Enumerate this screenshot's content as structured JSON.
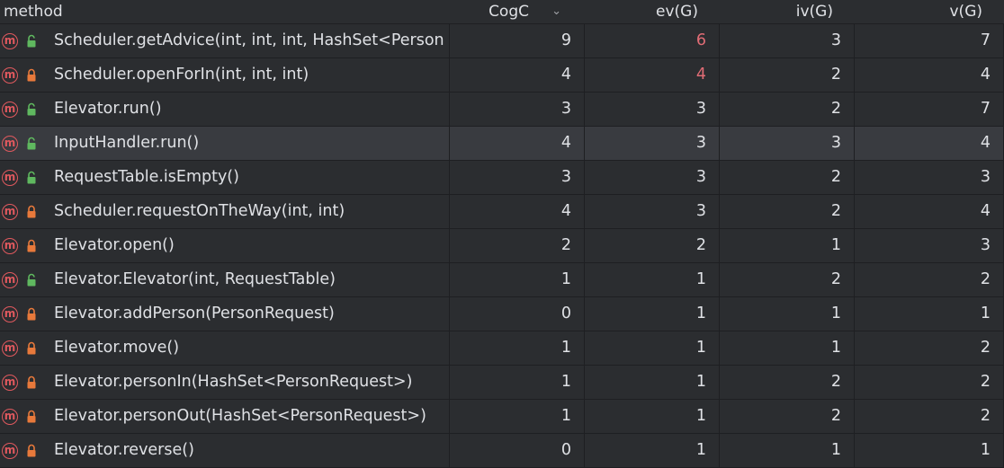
{
  "header": {
    "method": "method",
    "cogc": "CogC",
    "cogc_sort_icon": "chevron-down-icon",
    "ev": "ev(G)",
    "iv": "iv(G)",
    "v": "v(G)"
  },
  "colors": {
    "background": "#2b2d30",
    "selected_row": "#393b40",
    "method_icon": "#e0595e",
    "public_lock": "#5fb85f",
    "private_lock": "#e8793b",
    "highlight_value": "#e06c75"
  },
  "rows": [
    {
      "method": "Scheduler.getAdvice(int, int, int, HashSet<Person",
      "access": "public",
      "cogc": "9",
      "ev": "6",
      "iv": "3",
      "v": "7",
      "ev_highlight": true
    },
    {
      "method": "Scheduler.openForIn(int, int, int)",
      "access": "private",
      "cogc": "4",
      "ev": "4",
      "iv": "2",
      "v": "4",
      "ev_highlight": true
    },
    {
      "method": "Elevator.run()",
      "access": "public",
      "cogc": "3",
      "ev": "3",
      "iv": "2",
      "v": "7"
    },
    {
      "method": "InputHandler.run()",
      "access": "public",
      "cogc": "4",
      "ev": "3",
      "iv": "3",
      "v": "4",
      "selected": true
    },
    {
      "method": "RequestTable.isEmpty()",
      "access": "public",
      "cogc": "3",
      "ev": "3",
      "iv": "2",
      "v": "3"
    },
    {
      "method": "Scheduler.requestOnTheWay(int, int)",
      "access": "private",
      "cogc": "4",
      "ev": "3",
      "iv": "2",
      "v": "4"
    },
    {
      "method": "Elevator.open()",
      "access": "private",
      "cogc": "2",
      "ev": "2",
      "iv": "1",
      "v": "3"
    },
    {
      "method": "Elevator.Elevator(int, RequestTable)",
      "access": "public",
      "cogc": "1",
      "ev": "1",
      "iv": "2",
      "v": "2"
    },
    {
      "method": "Elevator.addPerson(PersonRequest)",
      "access": "private",
      "cogc": "0",
      "ev": "1",
      "iv": "1",
      "v": "1"
    },
    {
      "method": "Elevator.move()",
      "access": "private",
      "cogc": "1",
      "ev": "1",
      "iv": "1",
      "v": "2"
    },
    {
      "method": "Elevator.personIn(HashSet<PersonRequest>)",
      "access": "private",
      "cogc": "1",
      "ev": "1",
      "iv": "2",
      "v": "2"
    },
    {
      "method": "Elevator.personOut(HashSet<PersonRequest>)",
      "access": "private",
      "cogc": "1",
      "ev": "1",
      "iv": "2",
      "v": "2"
    },
    {
      "method": "Elevator.reverse()",
      "access": "private",
      "cogc": "0",
      "ev": "1",
      "iv": "1",
      "v": "1"
    }
  ]
}
